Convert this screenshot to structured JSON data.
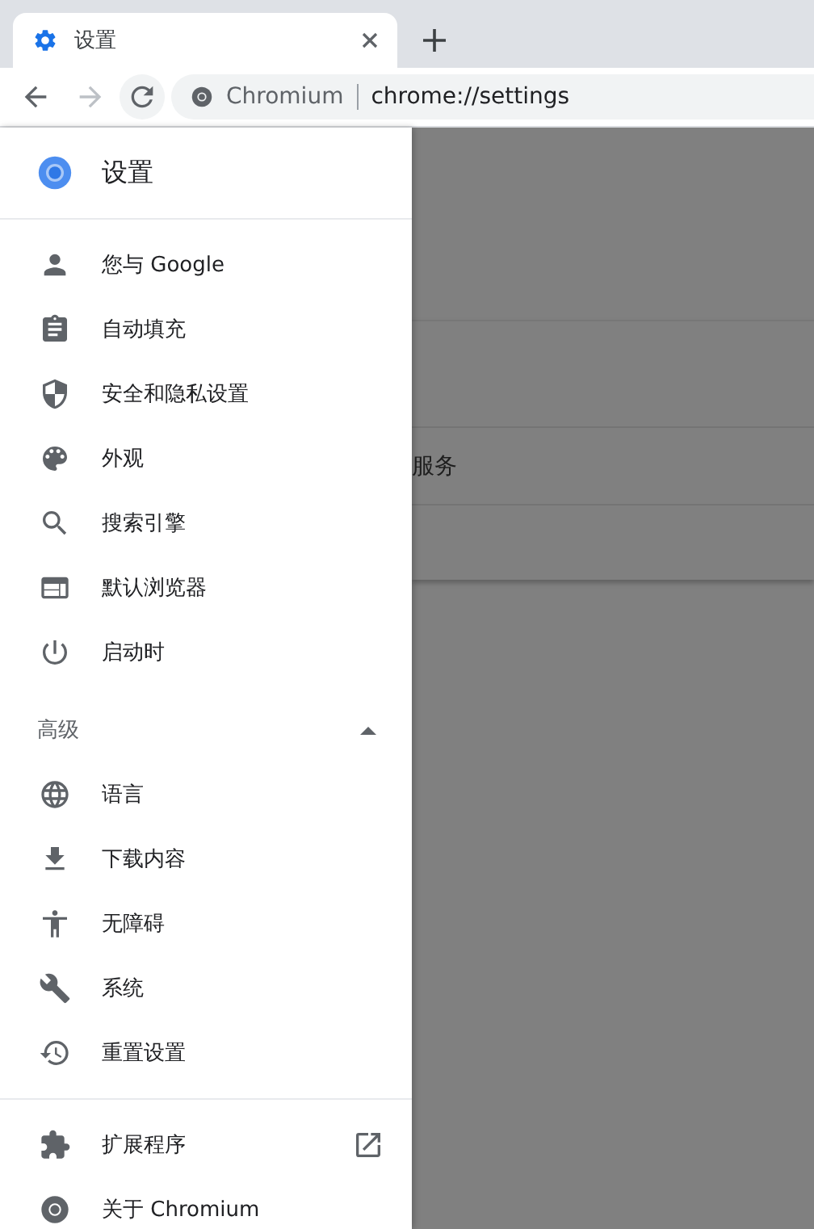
{
  "tabs": [
    {
      "title": "设置",
      "selected": true
    }
  ],
  "toolbar": {
    "forward_disabled": true,
    "site_name": "Chromium",
    "url": "chrome://settings"
  },
  "drawer": {
    "title": "设置",
    "sections": [
      {
        "items": [
          {
            "label": "您与 Google"
          },
          {
            "label": "自动填充"
          },
          {
            "label": "安全和隐私设置"
          },
          {
            "label": "外观"
          },
          {
            "label": "搜索引擎"
          },
          {
            "label": "默认浏览器"
          },
          {
            "label": "启动时"
          }
        ]
      },
      {
        "header": "高级",
        "expanded": true,
        "items": [
          {
            "label": "语言"
          },
          {
            "label": "下载内容"
          },
          {
            "label": "无障碍"
          },
          {
            "label": "系统"
          },
          {
            "label": "重置设置"
          }
        ]
      },
      {
        "items": [
          {
            "label": "扩展程序",
            "external": true
          },
          {
            "label": "关于 Chromium",
            "external": false
          }
        ]
      }
    ]
  },
  "background_page": {
    "row_text": "服务"
  }
}
